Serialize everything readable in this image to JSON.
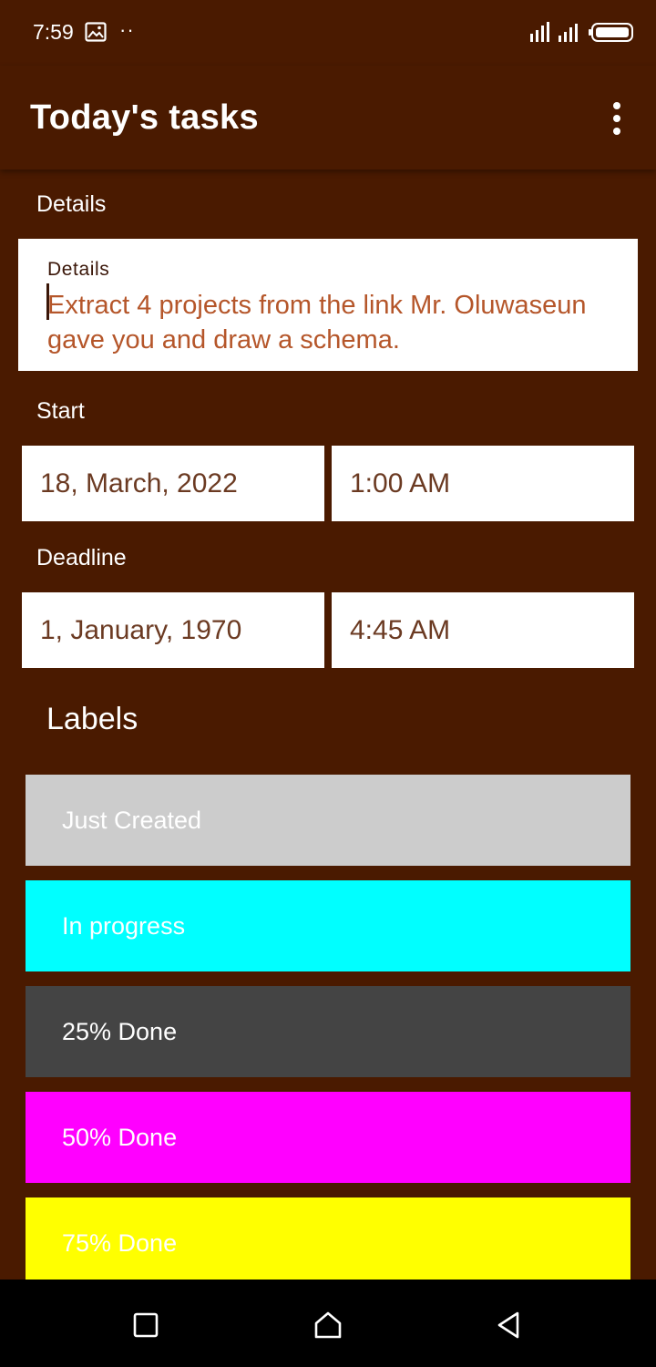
{
  "status_bar": {
    "time": "7:59",
    "icons": [
      "image-icon",
      "more-dots-icon",
      "signal-icon",
      "battery-icon"
    ],
    "dots": "··"
  },
  "app_bar": {
    "title": "Today's tasks",
    "menu_icon": "overflow-menu-icon"
  },
  "details": {
    "section_label": "Details",
    "floating_label": "Details",
    "value": "Extract 4 projects from the link Mr. Oluwaseun gave you and draw a schema."
  },
  "start": {
    "section_label": "Start",
    "date": "18, March, 2022",
    "time": "1:00 AM"
  },
  "deadline": {
    "section_label": "Deadline",
    "date": "1, January, 1970",
    "time": "4:45 AM"
  },
  "labels": {
    "heading": "Labels",
    "items": [
      {
        "label": "Just Created",
        "color": "#cccccc"
      },
      {
        "label": "In progress",
        "color": "#00ffff"
      },
      {
        "label": "25% Done",
        "color": "#444444"
      },
      {
        "label": "50% Done",
        "color": "#ff00ff"
      },
      {
        "label": "75% Done",
        "color": "#ffff00"
      }
    ]
  },
  "nav_bar": {
    "icons": [
      "recents-square-icon",
      "home-icon",
      "back-triangle-icon"
    ]
  },
  "colors": {
    "background": "#4a1a00",
    "field_background": "#ffffff",
    "details_text": "#b5562a",
    "field_text": "#6b3a22"
  }
}
